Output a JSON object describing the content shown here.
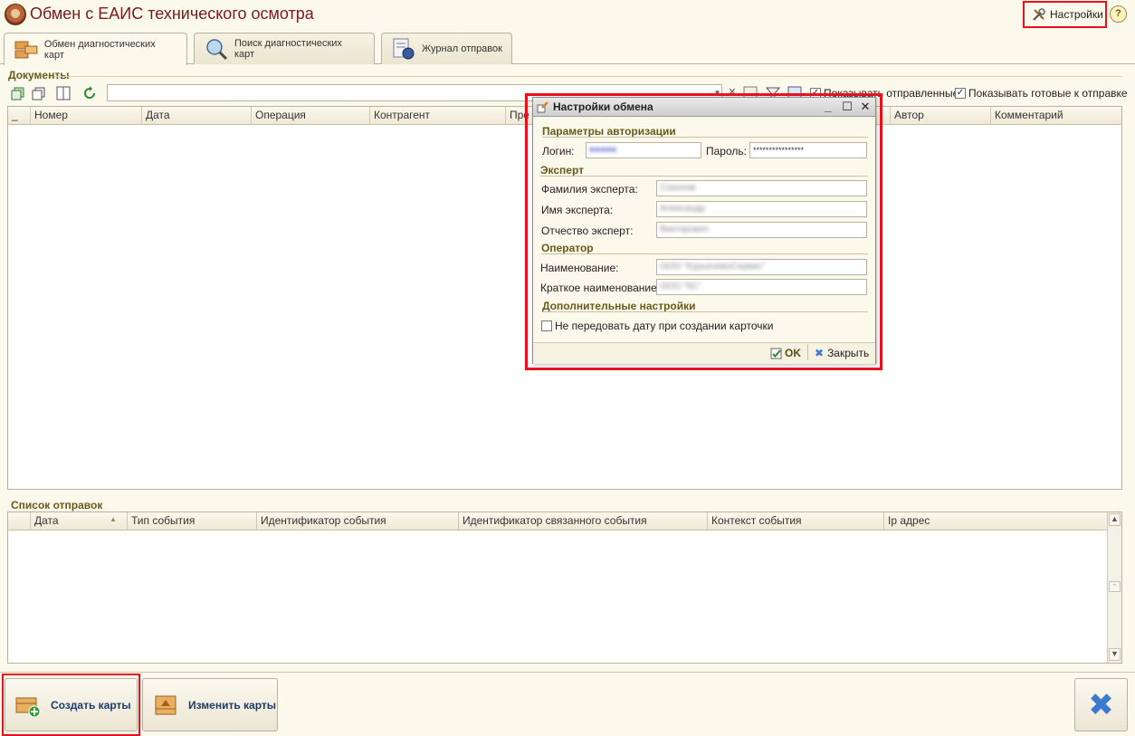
{
  "window": {
    "title": "Обмен с ЕАИС технического осмотра",
    "settings_label": "Настройки",
    "help_label": "?"
  },
  "tabs": [
    {
      "label": "Обмен диагностических карт",
      "active": true,
      "icon": "cards-icon"
    },
    {
      "label": "Поиск диагностических карт",
      "active": false,
      "icon": "search-globe-icon"
    },
    {
      "label": "Журнал отправок",
      "active": false,
      "icon": "journal-clock-icon"
    }
  ],
  "documents": {
    "section_label": "Документы",
    "filter_value": "",
    "checkbox_sent": {
      "label": "Показывать отправленные",
      "checked": true
    },
    "checkbox_ready": {
      "label": "Показывать готовые к отправке",
      "checked": true
    },
    "columns": [
      "_",
      "Номер",
      "Дата",
      "Операция",
      "Контрагент",
      "Пре",
      "Автор",
      "Комментарий"
    ]
  },
  "sends": {
    "section_label": "Список отправок",
    "columns": [
      "Дата",
      "Тип события",
      "Идентификатор события",
      "Идентификатор связанного события",
      "Контекст события",
      "Ip адрес"
    ]
  },
  "bottom": {
    "create_label": "Создать карты",
    "edit_label": "Изменить карты",
    "close_glyph": "✖"
  },
  "dialog": {
    "title": "Настройки обмена",
    "auth_section": "Параметры авторизации",
    "login_label": "Логин:",
    "login_value": "●●●●●",
    "password_label": "Пароль:",
    "password_value": "****************",
    "expert_section": "Эксперт",
    "surname_label": "Фамилия эксперта:",
    "surname_value": "Сазонов",
    "name_label": "Имя эксперта:",
    "name_value": "Александр",
    "patronymic_label": "Отчество эксперт:",
    "patronymic_value": "Викторович",
    "operator_section": "Оператор",
    "org_label": "Наименование:",
    "org_value": "ООО \"КурьеневоСервис\"",
    "short_label": "Краткое наименование:",
    "short_value": "ООО \"КС\"",
    "extra_section": "Дополнительные настройки",
    "no_date_label": "Не передовать дату при создании карточки",
    "no_date_checked": false,
    "ok_label": "OK",
    "close_label": "Закрыть"
  },
  "colors": {
    "accent_red": "#e8111e",
    "title_color": "#7a1a1a",
    "section_color": "#6a5a1a"
  }
}
